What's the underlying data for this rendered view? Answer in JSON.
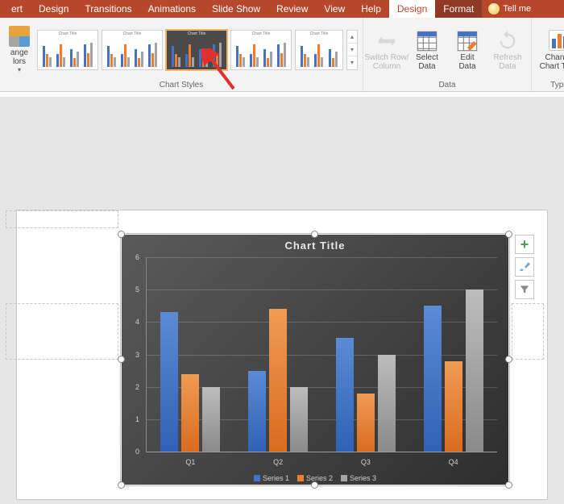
{
  "tabs": {
    "insert": "ert",
    "design_main": "Design",
    "transitions": "Transitions",
    "animations": "Animations",
    "slideshow": "Slide Show",
    "review": "Review",
    "view": "View",
    "help": "Help",
    "design_tool": "Design",
    "format_tool": "Format",
    "tellme": "Tell me"
  },
  "ribbon": {
    "change_colors": "ange\nlors",
    "chart_styles_label": "Chart Styles",
    "data_label": "Data",
    "type_label": "Type",
    "switch": "Switch Row/\nColumn",
    "select_data": "Select\nData",
    "edit_data": "Edit\nData",
    "refresh": "Refresh\nData",
    "change_type": "Change\nChart Type"
  },
  "side": {
    "plus": "+"
  },
  "chart_data": {
    "type": "bar",
    "title": "Chart Title",
    "ylim": [
      0,
      6
    ],
    "yticks": [
      0,
      1,
      2,
      3,
      4,
      5,
      6
    ],
    "categories": [
      "Q1",
      "Q2",
      "Q3",
      "Q4"
    ],
    "series": [
      {
        "name": "Series 1",
        "values": [
          4.3,
          2.5,
          3.5,
          4.5
        ]
      },
      {
        "name": "Series 2",
        "values": [
          2.4,
          4.4,
          1.8,
          2.8
        ]
      },
      {
        "name": "Series 3",
        "values": [
          2.0,
          2.0,
          3.0,
          5.0
        ]
      }
    ]
  }
}
